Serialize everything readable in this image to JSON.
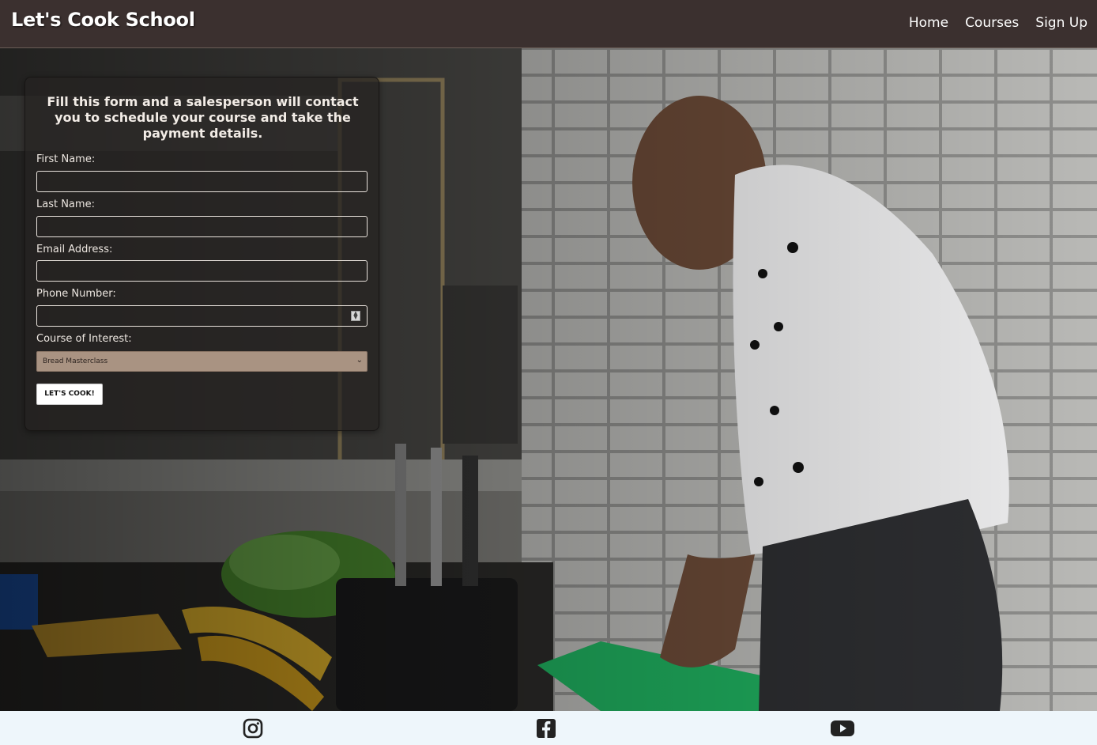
{
  "header": {
    "logo": "Let's Cook School",
    "nav": [
      "Home",
      "Courses",
      "Sign Up"
    ]
  },
  "form": {
    "title": "Fill this form and a salesperson will contact you to schedule your course and take the payment details.",
    "fields": [
      {
        "label": "First Name:",
        "value": ""
      },
      {
        "label": "Last Name:",
        "value": ""
      },
      {
        "label": "Email Address:",
        "value": ""
      },
      {
        "label": "Phone Number:",
        "value": ""
      }
    ],
    "course_label": "Course of Interest:",
    "course_selected": "Bread Masterclass",
    "submit_label": "LET'S COOK!"
  },
  "footer": {
    "icons": [
      "instagram-icon",
      "facebook-icon",
      "youtube-icon"
    ]
  },
  "colors": {
    "header_bg": "#3b302f",
    "select_bg": "#a99382",
    "footer_bg": "#eef6fb"
  }
}
